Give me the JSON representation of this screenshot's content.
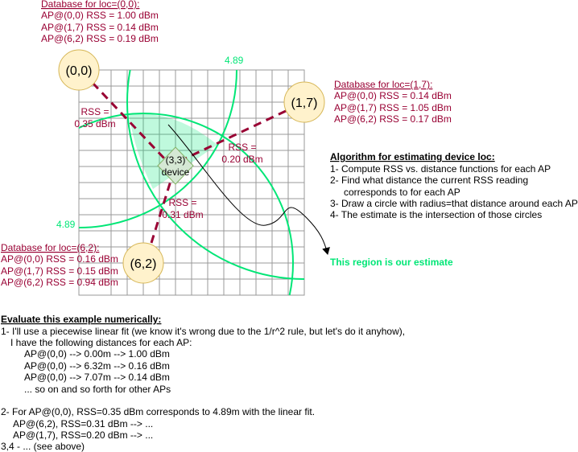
{
  "colors": {
    "accent_green": "#00e676",
    "ap_fill": "#fff2cc",
    "ap_stroke": "#d6b656",
    "text_red": "#990033",
    "grid": "#999999"
  },
  "dbs": {
    "loc00": {
      "title": "Database for loc=(0,0):",
      "lines": [
        "AP@(0,0) RSS = 1.00 dBm",
        "AP@(1,7) RSS = 0.14 dBm",
        "AP@(6,2) RSS = 0.19 dBm"
      ]
    },
    "loc17": {
      "title": "Database for loc=(1,7):",
      "lines": [
        "AP@(0,0) RSS = 0.14 dBm",
        "AP@(1,7) RSS = 1.05 dBm",
        "AP@(6,2) RSS = 0.17 dBm"
      ]
    },
    "loc62": {
      "title": "Database for loc=(6,2):",
      "lines": [
        "AP@(0,0) RSS = 0.16 dBm",
        "AP@(1,7) RSS = 0.15 dBm",
        "AP@(6,2) RSS = 0.94 dBm"
      ]
    }
  },
  "aps": [
    "(0,0)",
    "(1,7)",
    "(6,2)"
  ],
  "device": {
    "coord": "(3,3)",
    "label": "device"
  },
  "rss": {
    "ap00": [
      "RSS =",
      "0.35 dBm"
    ],
    "ap17": [
      "RSS =",
      "0.20 dBm"
    ],
    "ap62": [
      "RSS =",
      "0.31 dBm"
    ]
  },
  "radius_labels": [
    "4.89",
    "4.89"
  ],
  "algorithm": {
    "title": "Algorithm for estimating device loc:",
    "steps": [
      "1- Compute RSS vs. distance functions for each AP",
      "2- Find what distance the current RSS reading",
      "corresponds to for each AP",
      "3- Draw a circle with radius=that distance around each AP",
      "4- The estimate is the intersection of those circles"
    ]
  },
  "estimate_label": "This region is our estimate",
  "evaluate": {
    "title": "Evaluate this example numerically:",
    "lines": [
      "1- I'll use a piecewise linear fit (we know it's wrong due to the 1/r^2 rule, but let's do it anyhow),",
      "I have the following distances for each AP:",
      "AP@(0,0) --> 0.00m --> 1.00 dBm",
      "AP@(0,0) --> 6.32m --> 0.16 dBm",
      "AP@(0,0) --> 7.07m --> 0.14 dBm",
      "... so on and so forth for other APs",
      "2- For AP@(0,0), RSS=0.35 dBm corresponds to 4.89m with the linear fit.",
      "AP@(6,2), RSS=0.31 dBm --> ...",
      "AP@(1,7), RSS=0.20 dBm --> ...",
      "3,4 - ... (see above)"
    ]
  }
}
